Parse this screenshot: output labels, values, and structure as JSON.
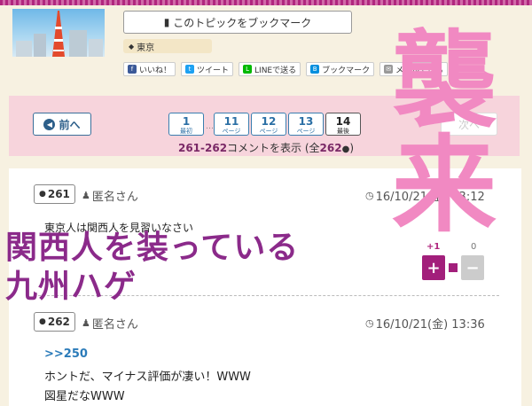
{
  "header": {
    "bookmark_topic": "このトピックをブックマーク",
    "tag": "東京",
    "share": [
      {
        "label": "いいね！",
        "icon": "facebook-icon",
        "color": "#3b5998"
      },
      {
        "label": "ツイート",
        "icon": "twitter-icon",
        "color": "#1da1f2"
      },
      {
        "label": "LINEで送る",
        "icon": "line-icon",
        "color": "#00b900"
      },
      {
        "label": "ブックマーク",
        "icon": "hatena-icon",
        "color": "#008fde"
      },
      {
        "label": "メールで送る",
        "icon": "mail-icon",
        "color": "#999999"
      }
    ]
  },
  "pager": {
    "prev": "前へ",
    "next": "次へ",
    "pages": [
      {
        "num": "1",
        "sub": "最初"
      },
      {
        "num": "11",
        "sub": "ページ"
      },
      {
        "num": "12",
        "sub": "ページ"
      },
      {
        "num": "13",
        "sub": "ページ"
      },
      {
        "num": "14",
        "sub": "最後"
      }
    ],
    "dots": "…",
    "range": "261-262",
    "range_suffix": "コメントを表示 (全",
    "total": "262",
    "total_suffix": ")"
  },
  "comments": [
    {
      "num": "261",
      "author": "匿名さん",
      "date": "16/10/21(金) 13:12",
      "lines": [
        "東京人は関西人を見習いなさい"
      ],
      "plus_count": "+1",
      "minus_count": "0"
    },
    {
      "num": "262",
      "author": "匿名さん",
      "date": "16/10/21(金) 13:36",
      "anchor": ">>250",
      "lines": [
        "ホントだ、マイナス評価が凄い！WWW",
        "図星だなWWW"
      ]
    }
  ],
  "overlay": {
    "big_top": "襲",
    "big_bottom": "来",
    "purple_line1": "関西人を装っている",
    "purple_line2": "九州ハゲ"
  },
  "colors": {
    "accent": "#a21f7b",
    "link": "#2b7bb9",
    "overlay_pink": "#f189c2",
    "overlay_purple": "#8b2a8a"
  }
}
